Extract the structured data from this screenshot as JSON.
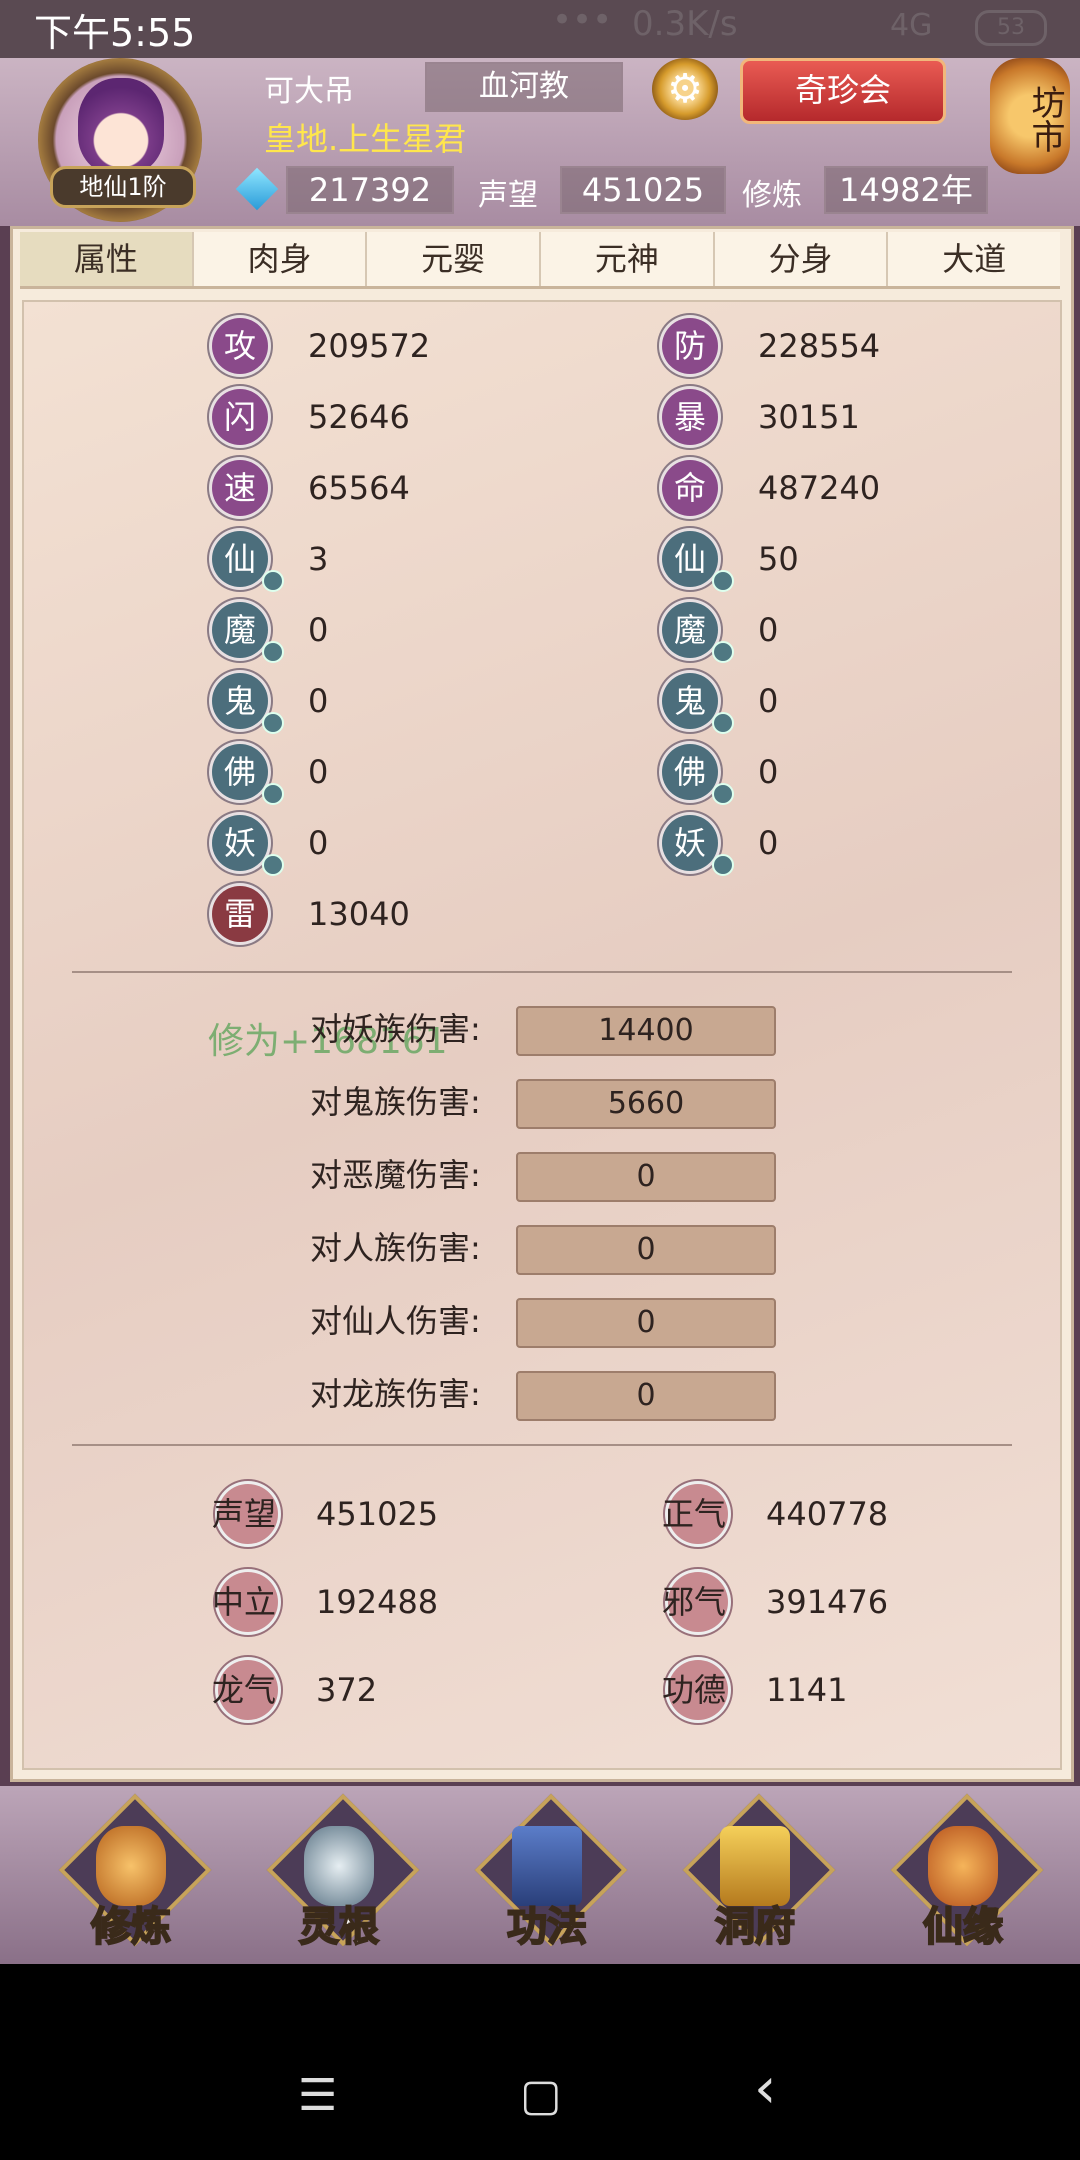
{
  "status_bar": {
    "time": "下午5:55",
    "dots": "•••",
    "network": "0.3K/s",
    "signal": "4G",
    "battery": "53"
  },
  "header": {
    "rank": "地仙1阶",
    "player_name": "可大吊",
    "sect": "血河教",
    "event_button": "奇珍会",
    "market_button": "坊市",
    "title": "皇地.上生星君",
    "gems": "217392",
    "fame_label": "声望",
    "fame": "451025",
    "cultivation_label": "修炼",
    "cultivation": "14982年"
  },
  "tabs": [
    "属性",
    "肉身",
    "元婴",
    "元神",
    "分身",
    "大道"
  ],
  "stats_left": [
    {
      "badge": "攻",
      "value": "209572"
    },
    {
      "badge": "闪",
      "value": "52646"
    },
    {
      "badge": "速",
      "value": "65564"
    },
    {
      "badge": "仙",
      "value": "3"
    },
    {
      "badge": "魔",
      "value": "0"
    },
    {
      "badge": "鬼",
      "value": "0"
    },
    {
      "badge": "佛",
      "value": "0"
    },
    {
      "badge": "妖",
      "value": "0"
    },
    {
      "badge": "雷",
      "value": "13040"
    }
  ],
  "stats_right": [
    {
      "badge": "防",
      "value": "228554"
    },
    {
      "badge": "暴",
      "value": "30151"
    },
    {
      "badge": "命",
      "value": "487240"
    },
    {
      "badge": "仙",
      "value": "50"
    },
    {
      "badge": "魔",
      "value": "0"
    },
    {
      "badge": "鬼",
      "value": "0"
    },
    {
      "badge": "佛",
      "value": "0"
    },
    {
      "badge": "妖",
      "value": "0"
    }
  ],
  "cultivation_float": "修为+168161",
  "damage": [
    {
      "label": "对妖族伤害:",
      "value": "14400"
    },
    {
      "label": "对鬼族伤害:",
      "value": "5660"
    },
    {
      "label": "对恶魔伤害:",
      "value": "0"
    },
    {
      "label": "对人族伤害:",
      "value": "0"
    },
    {
      "label": "对仙人伤害:",
      "value": "0"
    },
    {
      "label": "对龙族伤害:",
      "value": "0"
    }
  ],
  "reputation": [
    {
      "label": "声望",
      "value": "451025"
    },
    {
      "label": "正气",
      "value": "440778"
    },
    {
      "label": "中立",
      "value": "192488"
    },
    {
      "label": "邪气",
      "value": "391476"
    },
    {
      "label": "龙气",
      "value": "372"
    },
    {
      "label": "功德",
      "value": "1141"
    }
  ],
  "bottom_nav": [
    "修炼",
    "灵根",
    "功法",
    "洞府",
    "仙缘"
  ],
  "system_nav": {
    "menu": "☰",
    "home": "▢",
    "back": "‹"
  }
}
